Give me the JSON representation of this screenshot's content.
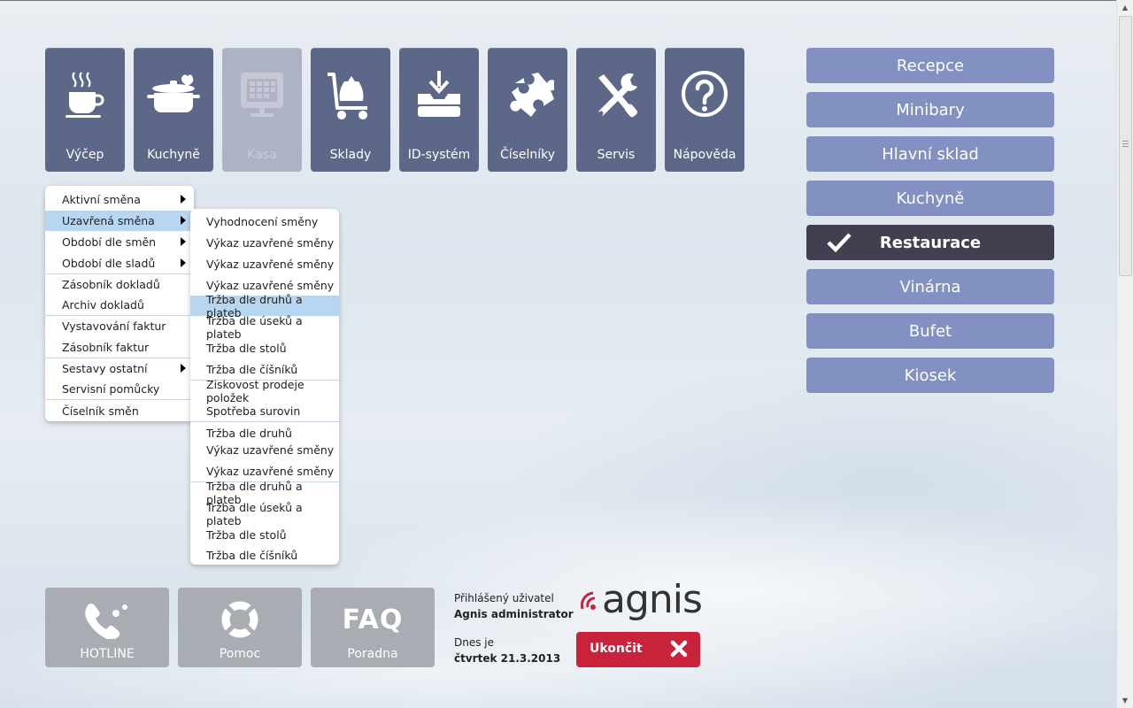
{
  "colors": {
    "tile": "#5d6889",
    "tile_disabled": "#adb3c4",
    "side_button": "#8390c2",
    "side_active": "#413f50",
    "menu_highlight": "#b9d6f0",
    "exit_button": "#c8233a",
    "bottom_tile": "#a9acb3"
  },
  "top_tiles": [
    {
      "label": "Výčep",
      "icon": "coffee-cup-icon"
    },
    {
      "label": "Kuchyně",
      "icon": "cooking-pot-icon"
    },
    {
      "label": "Kasa",
      "icon": "cash-register-icon",
      "disabled": true
    },
    {
      "label": "Sklady",
      "icon": "trolley-icon"
    },
    {
      "label": "ID-systém",
      "icon": "download-tray-icon"
    },
    {
      "label": "Číselníky",
      "icon": "puzzle-icon"
    },
    {
      "label": "Servis",
      "icon": "tools-icon"
    },
    {
      "label": "Nápověda",
      "icon": "question-icon"
    }
  ],
  "side_buttons": [
    {
      "label": "Recepce"
    },
    {
      "label": "Minibary"
    },
    {
      "label": "Hlavní sklad"
    },
    {
      "label": "Kuchyně"
    },
    {
      "label": "Restaurace",
      "active": true
    },
    {
      "label": "Vinárna"
    },
    {
      "label": "Bufet"
    },
    {
      "label": "Kiosek"
    }
  ],
  "menu1": [
    {
      "label": "Aktivní směna",
      "submenu": true
    },
    {
      "label": "Uzavřená směna",
      "submenu": true,
      "highlighted": true
    },
    {
      "label": "Období dle směn",
      "submenu": true
    },
    {
      "label": "Období dle sladů",
      "submenu": true
    },
    {
      "label": "Zásobník dokladů"
    },
    {
      "label": "Archiv dokladů"
    },
    {
      "label": "Vystavování faktur"
    },
    {
      "label": "Zásobník faktur"
    },
    {
      "label": "Sestavy ostatní",
      "submenu": true
    },
    {
      "label": "Servisní pomůcky"
    },
    {
      "label": "Číselník směn"
    }
  ],
  "menu2": [
    {
      "label": "Vyhodnocení směny"
    },
    {
      "label": "Výkaz uzavřené směny"
    },
    {
      "label": "Výkaz uzavřené směny"
    },
    {
      "label": "Výkaz uzavřené směny"
    },
    {
      "label": "Tržba dle druhů a plateb",
      "highlighted": true
    },
    {
      "label": "Tržba dle úseků a plateb"
    },
    {
      "label": "Tržba dle stolů"
    },
    {
      "label": "Tržba dle číšníků"
    },
    {
      "label": "Ziskovost prodeje položek"
    },
    {
      "label": "Spotřeba surovin"
    },
    {
      "label": "Tržba dle druhů"
    },
    {
      "label": "Výkaz uzavřené směny"
    },
    {
      "label": "Výkaz uzavřené směny"
    },
    {
      "label": "Tržba dle druhů a plateb"
    },
    {
      "label": "Tržba dle úseků a plateb"
    },
    {
      "label": "Tržba dle stolů"
    },
    {
      "label": "Tržba dle číšníků"
    }
  ],
  "bottom_tiles": [
    {
      "label": "HOTLINE",
      "icon": "phone-icon"
    },
    {
      "label": "Pomoc",
      "icon": "lifebuoy-icon"
    },
    {
      "label": "Poradna",
      "icon": "faq-icon",
      "icon_text": "FAQ"
    }
  ],
  "user": {
    "caption": "Přihlášený uživatel",
    "name": "Agnis administrator",
    "date_caption": "Dnes je",
    "date": "čtvrtek 21.3.2013"
  },
  "logo": {
    "text": "agnis"
  },
  "exit_button": {
    "label": "Ukončit"
  }
}
